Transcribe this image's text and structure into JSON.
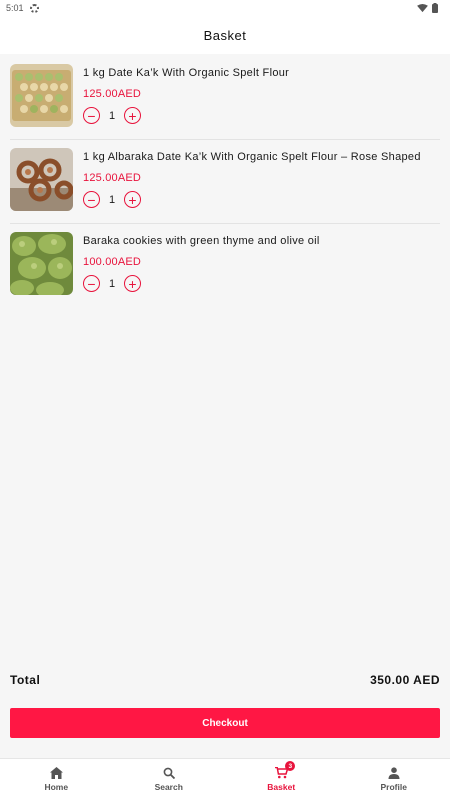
{
  "status_bar": {
    "time": "5:01"
  },
  "app_bar": {
    "title": "Basket"
  },
  "basket": {
    "items": [
      {
        "name": "1 kg Date Ka’k With Organic Spelt Flour",
        "price": "125.00AED",
        "quantity": "1"
      },
      {
        "name": "1 kg Albaraka Date Ka’k With Organic Spelt Flour – Rose Shaped",
        "price": "125.00AED",
        "quantity": "1"
      },
      {
        "name": "Baraka cookies with green thyme and olive oil",
        "price": "100.00AED",
        "quantity": "1"
      }
    ]
  },
  "summary": {
    "total_label": "Total",
    "total_value": "350.00 AED"
  },
  "checkout": {
    "label": "Checkout"
  },
  "bottom_nav": {
    "items": [
      {
        "label": "Home",
        "icon": "home-icon"
      },
      {
        "label": "Search",
        "icon": "search-icon"
      },
      {
        "label": "Basket",
        "icon": "cart-icon",
        "badge": "3"
      },
      {
        "label": "Profile",
        "icon": "person-icon"
      }
    ]
  },
  "colors": {
    "accent": "#e8133c",
    "checkout": "#ff1744",
    "background": "#f6f6f6"
  }
}
